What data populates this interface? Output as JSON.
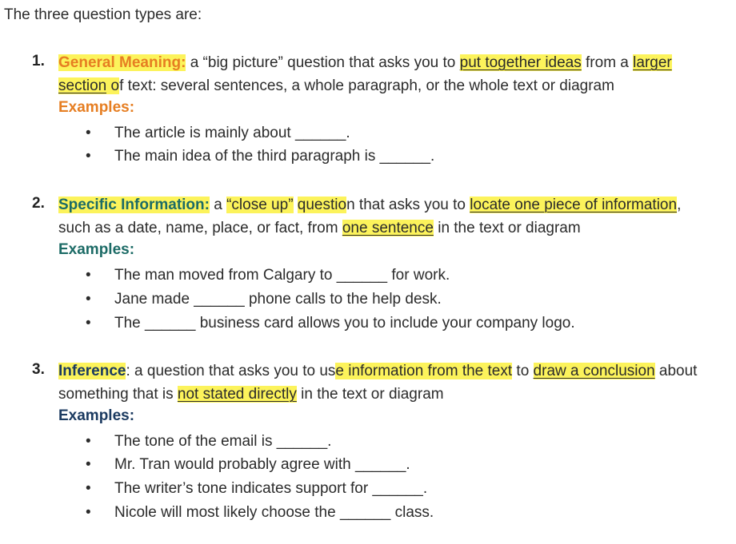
{
  "intro": "The three question types are:",
  "items": [
    {
      "number": "1.",
      "title": "General Meaning",
      "title_suffix": ":",
      "line1": {
        "a": " a “big picture” question that asks you to ",
        "hl1": "put together ideas",
        "b": " from a ",
        "hl2": "larger"
      },
      "line2": {
        "hl1": "section",
        "hl1b": " o",
        "rest": "f text: several sentences, a whole paragraph, or the whole text or diagram"
      },
      "examples_label": "Examples:",
      "examples": [
        "The article is mainly about ______.",
        "The main idea of the third paragraph is ______."
      ]
    },
    {
      "number": "2.",
      "title": "Specific Information:",
      "line1": {
        "a": " a ",
        "hl1": "“close up”",
        "b": " ",
        "hl2": "questio",
        "c": "n that asks you to ",
        "hl3": "locate one piece of information",
        "d": ","
      },
      "line2": {
        "a": "such as a date, name, place, or fact, from ",
        "hl1": "one sentence",
        "b": " in the text or diagram"
      },
      "examples_label": "Examples:",
      "examples": [
        "The man moved from Calgary to ______ for work.",
        "Jane made ______ phone calls to the help desk.",
        "The ______ business card allows you to include your company logo."
      ]
    },
    {
      "number": "3.",
      "title": "Inference",
      "line1": {
        "a": ": a question that asks you to us",
        "hl1": "e information from the text",
        "b": " to ",
        "hl2": "draw a conclusion",
        "c": " about"
      },
      "line2": {
        "a": "something that is ",
        "hl1": "not stated directly",
        "b": " in the text or diagram"
      },
      "examples_label": "Examples:",
      "examples": [
        "The tone of the email is ______.",
        "Mr. Tran would probably agree with ______.",
        "The writer’s tone indicates support for ______.",
        "Nicole will most likely choose the ______ class."
      ]
    }
  ],
  "bullet_glyph": "•",
  "colors": {
    "highlight": "#fcf35b",
    "type1": "#e67e22",
    "type2": "#1c6b66",
    "type3": "#1b3a60",
    "text": "#2b2b2b"
  }
}
